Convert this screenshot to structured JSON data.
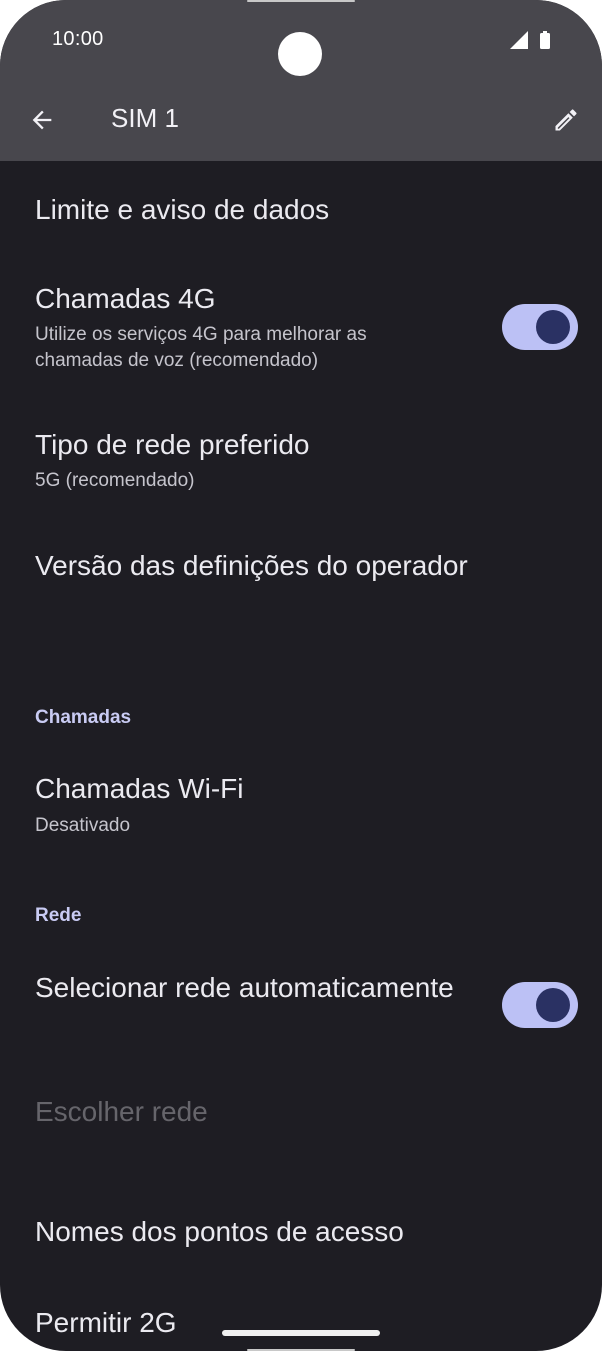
{
  "status_bar": {
    "time": "10:00",
    "signal_icon": "signal-icon",
    "battery_icon": "battery-icon"
  },
  "app_bar": {
    "title": "SIM 1",
    "back_icon": "arrow-back-icon",
    "edit_icon": "pencil-edit-icon"
  },
  "items": {
    "data_limit": {
      "title": "Limite e aviso de dados"
    },
    "calls_4g": {
      "title": "Chamadas 4G",
      "subtitle": "Utilize os serviços 4G para melhorar as chamadas de voz (recomendado)",
      "toggle_on": true
    },
    "network_type": {
      "title": "Tipo de rede preferido",
      "subtitle": "5G (recomendado)"
    },
    "carrier_version": {
      "title": "Versão das definições do operador"
    },
    "calls_header": "Chamadas",
    "wifi_calls": {
      "title": "Chamadas Wi-Fi",
      "subtitle": "Desativado"
    },
    "network_header": "Rede",
    "auto_network": {
      "title": "Selecionar rede automaticamente",
      "toggle_on": true
    },
    "choose_network": {
      "title": "Escolher rede",
      "enabled": false
    },
    "apn": {
      "title": "Nomes dos pontos de acesso"
    },
    "allow_2g": {
      "title": "Permitir 2G"
    }
  },
  "colors": {
    "background": "#1e1d23",
    "app_bar": "#48474d",
    "toggle_track": "#bcc1f5",
    "toggle_thumb": "#2a3163",
    "section_header": "#c9cbf3"
  }
}
